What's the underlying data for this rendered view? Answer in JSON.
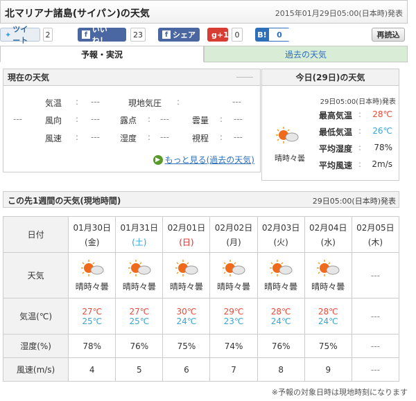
{
  "header": {
    "title": "北マリアナ諸島(サイパン)の天気",
    "issued": "2015年01月29日05:00(日本時)発表"
  },
  "social": {
    "tweet": "ツイート",
    "tweet_count": "2",
    "like": "いいね！",
    "like_count": "23",
    "share": "シェア",
    "gplus": "g+1",
    "gplus_count": "0",
    "hatena": "B!",
    "hatena_count": "0",
    "reload": "再読込"
  },
  "tabs": [
    {
      "label": "予報・実況",
      "active": true
    },
    {
      "label": "過去の天気",
      "active": false
    }
  ],
  "current": {
    "title": "現在の天気",
    "colon": ":",
    "empty": "---",
    "labels": [
      "気温",
      "現地気圧",
      "風向",
      "露点",
      "雲量",
      "風速",
      "湿度",
      "視程"
    ],
    "more_link": "もっと見る(過去の天気)"
  },
  "today": {
    "title": "今日(29日)の天気",
    "issued": "29日05:00(日本時)発表",
    "weather_text": "晴時々曇",
    "rows": [
      {
        "label": "最高気温",
        "value": "28℃",
        "color": "#e84a3a"
      },
      {
        "label": "最低気温",
        "value": "26℃",
        "color": "#3aa3d5"
      },
      {
        "label": "平均湿度",
        "value": "78%",
        "color": "#333333"
      },
      {
        "label": "平均風速",
        "value": "2m/s",
        "color": "#333333"
      }
    ]
  },
  "week": {
    "title": "この先1週間の天気(現地時間)",
    "issued": "29日05:00(日本時)発表",
    "row_labels": [
      "日付",
      "天気",
      "気温(℃)",
      "湿度(%)",
      "風速(m/s)"
    ],
    "days": [
      {
        "date": "01月30日",
        "dow": "(金)",
        "dow_color": "#333333",
        "weather": "晴時々曇",
        "high": "27℃",
        "low": "25℃",
        "humidity": "78%",
        "wind": "4"
      },
      {
        "date": "01月31日",
        "dow": "(土)",
        "dow_color": "#2aa3d5",
        "weather": "晴時々曇",
        "high": "27℃",
        "low": "25℃",
        "humidity": "76%",
        "wind": "5"
      },
      {
        "date": "02月01日",
        "dow": "(日)",
        "dow_color": "#ee2222",
        "weather": "晴時々曇",
        "high": "30℃",
        "low": "24℃",
        "humidity": "75%",
        "wind": "6"
      },
      {
        "date": "02月02日",
        "dow": "(月)",
        "dow_color": "#333333",
        "weather": "晴時々曇",
        "high": "29℃",
        "low": "23℃",
        "humidity": "74%",
        "wind": "7"
      },
      {
        "date": "02月03日",
        "dow": "(火)",
        "dow_color": "#333333",
        "weather": "晴時々曇",
        "high": "28℃",
        "low": "24℃",
        "humidity": "76%",
        "wind": "8"
      },
      {
        "date": "02月04日",
        "dow": "(水)",
        "dow_color": "#333333",
        "weather": "晴時々曇",
        "high": "28℃",
        "low": "24℃",
        "humidity": "75%",
        "wind": "9"
      },
      {
        "date": "02月05日",
        "dow": "(木)",
        "dow_color": "#333333",
        "weather": "---",
        "high": "",
        "low": "---",
        "humidity": "---",
        "wind": "---"
      }
    ],
    "note": "※予報の対象日時は現地時刻になります"
  }
}
